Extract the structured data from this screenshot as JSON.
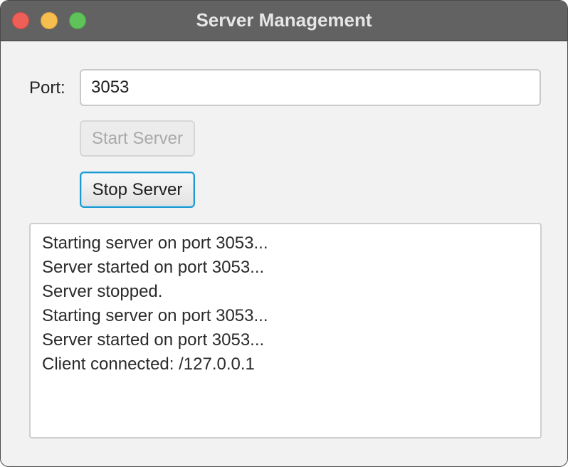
{
  "window": {
    "title": "Server Management"
  },
  "form": {
    "port_label": "Port:",
    "port_value": "3053"
  },
  "buttons": {
    "start_label": "Start Server",
    "start_enabled": false,
    "stop_label": "Stop Server",
    "stop_focused": true
  },
  "log": {
    "lines": [
      "Starting server on port 3053...",
      "Server started on port 3053...",
      "Server stopped.",
      "Starting server on port 3053...",
      "Server started on port 3053...",
      "Client connected: /127.0.0.1"
    ]
  },
  "icons": {
    "close": "close-traffic-light-icon",
    "minimize": "minimize-traffic-light-icon",
    "zoom": "zoom-traffic-light-icon"
  },
  "colors": {
    "titlebar": "#626262",
    "focus_ring": "#1c9bd3",
    "close": "#ee5f58",
    "minimize": "#f6bd4f",
    "zoom": "#5fc25b"
  }
}
